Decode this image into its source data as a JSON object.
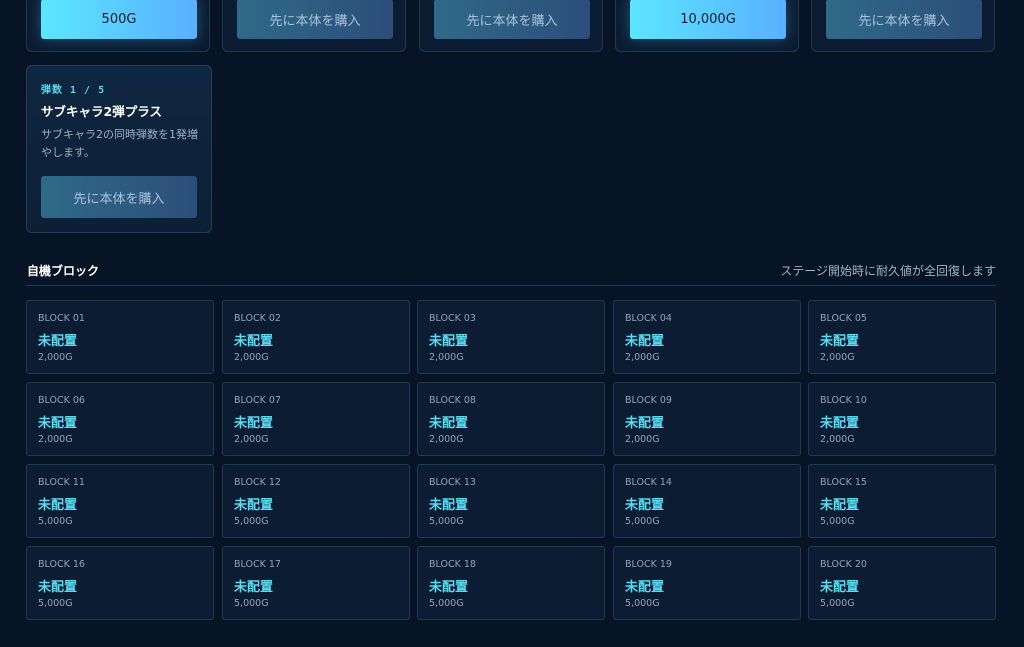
{
  "top_cards": [
    {
      "button_label": "500G",
      "state": "buy"
    },
    {
      "button_label": "先に本体を購入",
      "state": "disabled"
    },
    {
      "button_label": "先に本体を購入",
      "state": "disabled"
    },
    {
      "button_label": "10,000G",
      "state": "buy"
    },
    {
      "button_label": "先に本体を購入",
      "state": "disabled"
    }
  ],
  "upgrade_card": {
    "count": "弾数 1 / 5",
    "title": "サブキャラ2弾プラス",
    "description": "サブキャラ2の同時弾数を1発増やします。",
    "button_label": "先に本体を購入"
  },
  "section": {
    "title": "自機ブロック",
    "note": "ステージ開始時に耐久値が全回復します"
  },
  "blocks": [
    {
      "id": "BLOCK 01",
      "status": "未配置",
      "price": "2,000G"
    },
    {
      "id": "BLOCK 02",
      "status": "未配置",
      "price": "2,000G"
    },
    {
      "id": "BLOCK 03",
      "status": "未配置",
      "price": "2,000G"
    },
    {
      "id": "BLOCK 04",
      "status": "未配置",
      "price": "2,000G"
    },
    {
      "id": "BLOCK 05",
      "status": "未配置",
      "price": "2,000G"
    },
    {
      "id": "BLOCK 06",
      "status": "未配置",
      "price": "2,000G"
    },
    {
      "id": "BLOCK 07",
      "status": "未配置",
      "price": "2,000G"
    },
    {
      "id": "BLOCK 08",
      "status": "未配置",
      "price": "2,000G"
    },
    {
      "id": "BLOCK 09",
      "status": "未配置",
      "price": "2,000G"
    },
    {
      "id": "BLOCK 10",
      "status": "未配置",
      "price": "2,000G"
    },
    {
      "id": "BLOCK 11",
      "status": "未配置",
      "price": "5,000G"
    },
    {
      "id": "BLOCK 12",
      "status": "未配置",
      "price": "5,000G"
    },
    {
      "id": "BLOCK 13",
      "status": "未配置",
      "price": "5,000G"
    },
    {
      "id": "BLOCK 14",
      "status": "未配置",
      "price": "5,000G"
    },
    {
      "id": "BLOCK 15",
      "status": "未配置",
      "price": "5,000G"
    },
    {
      "id": "BLOCK 16",
      "status": "未配置",
      "price": "5,000G"
    },
    {
      "id": "BLOCK 17",
      "status": "未配置",
      "price": "5,000G"
    },
    {
      "id": "BLOCK 18",
      "status": "未配置",
      "price": "5,000G"
    },
    {
      "id": "BLOCK 19",
      "status": "未配置",
      "price": "5,000G"
    },
    {
      "id": "BLOCK 20",
      "status": "未配置",
      "price": "5,000G"
    }
  ],
  "colors": {
    "background": "#071426",
    "accent_cyan": "#57dcf2",
    "buy_gradient_start": "#5be6ff",
    "buy_gradient_end": "#5ab0ff",
    "disabled_button": "#2f6a88"
  }
}
